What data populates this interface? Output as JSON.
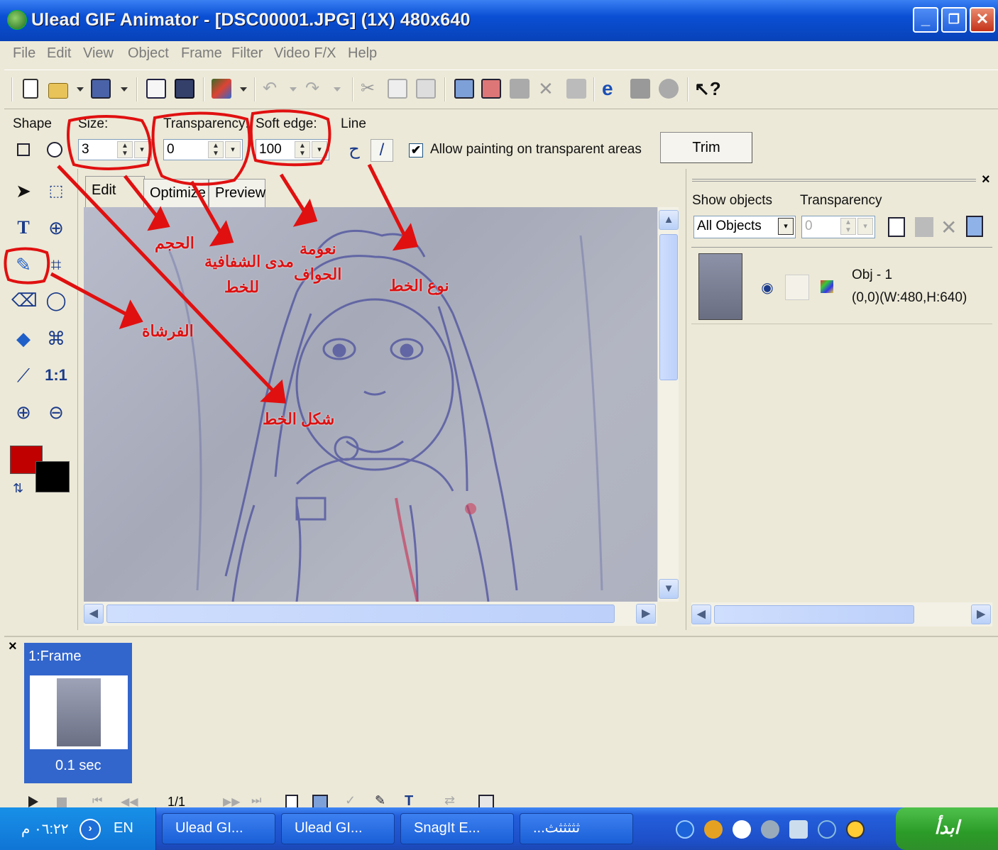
{
  "window": {
    "title": "Ulead GIF Animator - [DSC00001.JPG] (1X) 480x640",
    "min_glyph": "_",
    "max_glyph": "❐",
    "close_glyph": "✕"
  },
  "menu": [
    "File",
    "Edit",
    "View",
    "Object",
    "Frame",
    "Filter",
    "Video F/X",
    "Help"
  ],
  "options": {
    "shape_label": "Shape",
    "size_label": "Size:",
    "size_value": "3",
    "transparency_label": "Transparency:",
    "transparency_value": "0",
    "soft_edge_label": "Soft edge:",
    "soft_edge_value": "100",
    "line_label": "Line",
    "allow_painting_label": "Allow painting on transparent areas",
    "allow_painting_checked": "✔",
    "trim_label": "Trim"
  },
  "tools": {
    "ratio_label": "1:1"
  },
  "tabs": [
    "Edit",
    "Optimize",
    "Preview"
  ],
  "annotations": {
    "size": "الحجم",
    "transparency_1": "مدى الشفافية",
    "transparency_2": "للخط",
    "soft_edge_1": "نعومة",
    "soft_edge_2": "الحواف",
    "line_type": "نوع الخط",
    "brush": "الفرشاة",
    "line_shape": "شكل الخط"
  },
  "object_panel": {
    "close_glyph": "×",
    "show_objects_label": "Show objects",
    "transparency_label": "Transparency",
    "show_objects_value": "All Objects",
    "transparency_value": "0",
    "object_name": "Obj - 1",
    "object_info": "(0,0)(W:480,H:640)"
  },
  "frames": {
    "close_glyph": "×",
    "frame_label": "1:Frame",
    "frame_delay": "0.1 sec",
    "page_counter": "1/1"
  },
  "taskbar": {
    "clock": "٠٦:٢٢ م",
    "language": "EN",
    "buttons": [
      "Ulead GI...",
      "Ulead GI...",
      "SnagIt E...",
      "...ثثثثثث"
    ],
    "start_label": "ابدأ"
  },
  "colors": {
    "foreground": "#c00000",
    "background": "#000000",
    "annotation": "#dd1111"
  }
}
